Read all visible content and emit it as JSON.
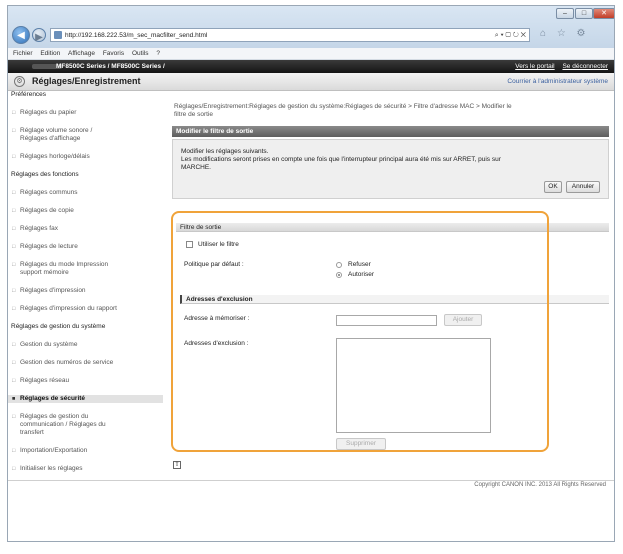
{
  "browser": {
    "window_controls": [
      "–",
      "□",
      "✕"
    ],
    "address_url": "http://192.168.222.53/m_sec_macfilter_send.html",
    "address_tools": "⌕ ▾ ▢ ↻ ✕",
    "toolbar_icons": "⌂ ☆ ⚙",
    "menu": [
      "Fichier",
      "Edition",
      "Affichage",
      "Favoris",
      "Outils",
      "?"
    ]
  },
  "device_bar": {
    "device_name": "MF8500C Series / MF8500C Series /",
    "portal_link": "Vers le portail",
    "logout_link": "Se déconnecter"
  },
  "header": {
    "title": "Réglages/Enregistrement",
    "admin_label": "Courrier à l'administrateur système"
  },
  "sidebar": [
    {
      "label": "Préférences",
      "kind": "cat"
    },
    {
      "label": "Réglages du papier",
      "kind": "sub"
    },
    {
      "label": "Réglage volume sonore /",
      "label2": "Réglages d'affichage",
      "kind": "sub"
    },
    {
      "label": "Réglages horloge/délais",
      "kind": "sub"
    },
    {
      "label": "Réglages des fonctions",
      "kind": "cat"
    },
    {
      "label": "Réglages communs",
      "kind": "sub"
    },
    {
      "label": "Réglages de copie",
      "kind": "sub"
    },
    {
      "label": "Réglages fax",
      "kind": "sub"
    },
    {
      "label": "Réglages de lecture",
      "kind": "sub"
    },
    {
      "label": "Réglages du mode Impression",
      "label2": "support mémoire",
      "kind": "sub"
    },
    {
      "label": "Réglages d'impression",
      "kind": "sub"
    },
    {
      "label": "Réglages d'impression du rapport",
      "kind": "sub"
    },
    {
      "label": "Réglages de gestion du système",
      "kind": "cat"
    },
    {
      "label": "Gestion du système",
      "kind": "sub"
    },
    {
      "label": "Gestion des numéros de service",
      "kind": "sub"
    },
    {
      "label": "Réglages réseau",
      "kind": "sub"
    },
    {
      "label": "Réglages de sécurité",
      "kind": "sub",
      "active": true
    },
    {
      "label": "Réglages de gestion du",
      "label2": "communication / Réglages du",
      "label3": "transfert",
      "kind": "sub"
    },
    {
      "label": "Importation/Exportation",
      "kind": "sub"
    },
    {
      "label": "Initialiser les réglages",
      "kind": "sub"
    }
  ],
  "main": {
    "breadcrumb_line1": "Réglages/Enregistrement:Réglages de gestion du système:Réglages de sécurité > Filtre d'adresse MAC > Modifier le",
    "breadcrumb_line2": "filtre de sortie",
    "panel_title": "Modifier le filtre de sortie",
    "msg_line1": "Modifier les réglages suivants.",
    "msg_line2": "Les modifications seront prises en compte une fois que l'interrupteur principal aura été mis sur ARRET, puis sur",
    "msg_line3": "MARCHE.",
    "ok_button": "OK",
    "cancel_button": "Annuler",
    "output_filter_header": "Filtre de sortie",
    "use_filter_label": "Utiliser le filtre",
    "use_filter_checked": false,
    "default_policy_label": "Politique par défaut :",
    "policy_options": [
      {
        "label": "Refuser",
        "selected": false
      },
      {
        "label": "Autoriser",
        "selected": true
      }
    ],
    "exceptions_header": "Adresses d'exclusion",
    "address_to_store_label": "Adresse à mémoriser :",
    "address_to_store_value": "",
    "add_button": "Ajouter",
    "exception_addresses_label": "Adresses d'exclusion :",
    "delete_button": "Supprimer"
  },
  "footer": {
    "copyright": "Copyright CANON INC. 2013 All Rights Reserved"
  },
  "colors": {
    "highlight": "#f0a33a",
    "panel_header": "#6e6e6e"
  }
}
